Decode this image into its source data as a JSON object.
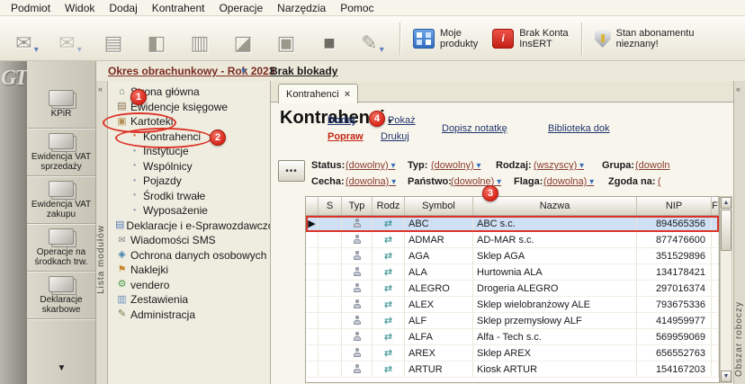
{
  "menu": {
    "items": [
      "Podmiot",
      "Widok",
      "Dodaj",
      "Kontrahent",
      "Operacje",
      "Narzędzia",
      "Pomoc"
    ]
  },
  "toolbar": {
    "moje_produkty": {
      "line1": "Moje",
      "line2": "produkty"
    },
    "brak_konta": {
      "line1": "Brak Konta",
      "line2": "InsERT"
    },
    "stan_abonamentu": {
      "line1": "Stan abonamentu",
      "line2": "nieznany!"
    },
    "insert_logo_text": "i"
  },
  "periodbar": {
    "period": "Okres obrachunkowy - Rok 2023",
    "lock": "Brak blokady"
  },
  "modules": {
    "logo": "GT",
    "vertical_label": "Lista modułów",
    "items": [
      "KPiR",
      "Ewidencja VAT sprzedaży",
      "Ewidencja VAT zakupu",
      "Operacje na środkach trw.",
      "Deklaracje skarbowe"
    ]
  },
  "tree": {
    "items": [
      {
        "label": "Strona główna",
        "icon": "home-icon"
      },
      {
        "label": "Ewidencje księgowe",
        "icon": "book-icon"
      },
      {
        "label": "Kartoteki",
        "icon": "card-file-icon"
      },
      {
        "label": "Kontrahenci",
        "icon": "bullet-icon"
      },
      {
        "label": "Instytucje",
        "icon": "bullet-icon"
      },
      {
        "label": "Wspólnicy",
        "icon": "bullet-icon"
      },
      {
        "label": "Pojazdy",
        "icon": "bullet-icon"
      },
      {
        "label": "Środki trwałe",
        "icon": "bullet-icon"
      },
      {
        "label": "Wyposażenie",
        "icon": "bullet-icon"
      },
      {
        "label": "Deklaracje i e-Sprawozdawczość",
        "icon": "document-icon"
      },
      {
        "label": "Wiadomości SMS",
        "icon": "mail-icon"
      },
      {
        "label": "Ochrona danych osobowych",
        "icon": "shield-icon"
      },
      {
        "label": "Naklejki",
        "icon": "tag-icon"
      },
      {
        "label": "vendero",
        "icon": "gear-icon"
      },
      {
        "label": "Zestawienia",
        "icon": "chart-icon"
      },
      {
        "label": "Administracja",
        "icon": "tools-icon"
      }
    ]
  },
  "workspace": {
    "tab": "Kontrahenci",
    "title": "Kontrahenci",
    "vertical_label": "Obszar roboczy",
    "actions": {
      "dodaj": "Dodaj",
      "pokaz": "Pokaż",
      "popraw": "Popraw",
      "drukuj": "Drukuj",
      "dopisz_notatke": "Dopisz notatkę",
      "biblioteka": "Biblioteka dok"
    },
    "filters": {
      "row1": [
        {
          "label": "Status:",
          "value": "(dowolny)"
        },
        {
          "label": "Typ:",
          "value": "(dowolny)"
        },
        {
          "label": "Rodzaj:",
          "value": "(wszyscy)"
        },
        {
          "label": "Grupa:",
          "value": "(dowoln"
        }
      ],
      "row2": [
        {
          "label": "Cecha:",
          "value": "(dowolna)"
        },
        {
          "label": "Państwo:",
          "value": "(dowolne)"
        },
        {
          "label": "Flaga:",
          "value": "(dowolna)"
        },
        {
          "label": "Zgoda na:",
          "value": "("
        }
      ]
    }
  },
  "table": {
    "columns": [
      "",
      "S",
      "Typ",
      "Rodz",
      "Symbol",
      "Nazwa",
      "NIP",
      "F"
    ],
    "rows": [
      {
        "symbol": "ABC",
        "nazwa": "ABC s.c.",
        "nip": "894565356"
      },
      {
        "symbol": "ADMAR",
        "nazwa": "AD-MAR s.c.",
        "nip": "877476600"
      },
      {
        "symbol": "AGA",
        "nazwa": "Sklep AGA",
        "nip": "351529896"
      },
      {
        "symbol": "ALA",
        "nazwa": "Hurtownia ALA",
        "nip": "134178421"
      },
      {
        "symbol": "ALEGRO",
        "nazwa": "Drogeria ALEGRO",
        "nip": "297016374"
      },
      {
        "symbol": "ALEX",
        "nazwa": "Sklep wielobranżowy  ALE",
        "nip": "793675336"
      },
      {
        "symbol": "ALF",
        "nazwa": "Sklep przemysłowy ALF",
        "nip": "414959977"
      },
      {
        "symbol": "ALFA",
        "nazwa": "Alfa - Tech s.c.",
        "nip": "569959069"
      },
      {
        "symbol": "AREX",
        "nazwa": "Sklep AREX",
        "nip": "656552763"
      },
      {
        "symbol": "ARTUR",
        "nazwa": "Kiosk ARTUR",
        "nip": "154167203"
      }
    ]
  },
  "annotations": {
    "badge1": "1",
    "badge2": "2",
    "badge3": "3",
    "badge4": "4"
  },
  "icons": {
    "dropdown": "▾",
    "close": "×",
    "row_pointer": "▶",
    "transfer": "⇄",
    "dots": "•••",
    "down_arrow": "▼",
    "scroll_up": "▲",
    "scroll_down": "▼",
    "collapse": "«"
  },
  "colors": {
    "annotation_red": "#dd3327",
    "selected_row": "#cfe0f5",
    "link_navy": "#22356f",
    "value_maroon": "#8a3a2e"
  }
}
